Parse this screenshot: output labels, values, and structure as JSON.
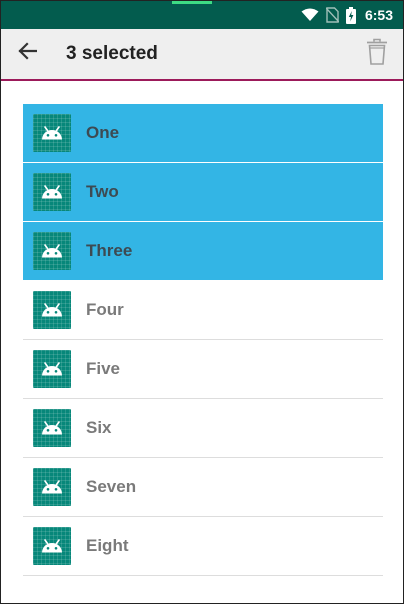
{
  "status_bar": {
    "time": "6:53",
    "icons": [
      "wifi-icon",
      "no-sim-icon",
      "battery-charging-icon"
    ]
  },
  "app_bar": {
    "title": "3 selected",
    "back_icon": "arrow-left-icon",
    "delete_icon": "trash-icon"
  },
  "colors": {
    "status_bar": "#035c4e",
    "app_bar": "#efefef",
    "app_bar_divider": "#9c1a5a",
    "selected_row": "#33b5e5",
    "item_icon_bg": "#07877a"
  },
  "list": {
    "items": [
      {
        "label": "One",
        "selected": true,
        "icon": "android-icon"
      },
      {
        "label": "Two",
        "selected": true,
        "icon": "android-icon"
      },
      {
        "label": "Three",
        "selected": true,
        "icon": "android-icon"
      },
      {
        "label": "Four",
        "selected": false,
        "icon": "android-icon"
      },
      {
        "label": "Five",
        "selected": false,
        "icon": "android-icon"
      },
      {
        "label": "Six",
        "selected": false,
        "icon": "android-icon"
      },
      {
        "label": "Seven",
        "selected": false,
        "icon": "android-icon"
      },
      {
        "label": "Eight",
        "selected": false,
        "icon": "android-icon"
      }
    ]
  }
}
